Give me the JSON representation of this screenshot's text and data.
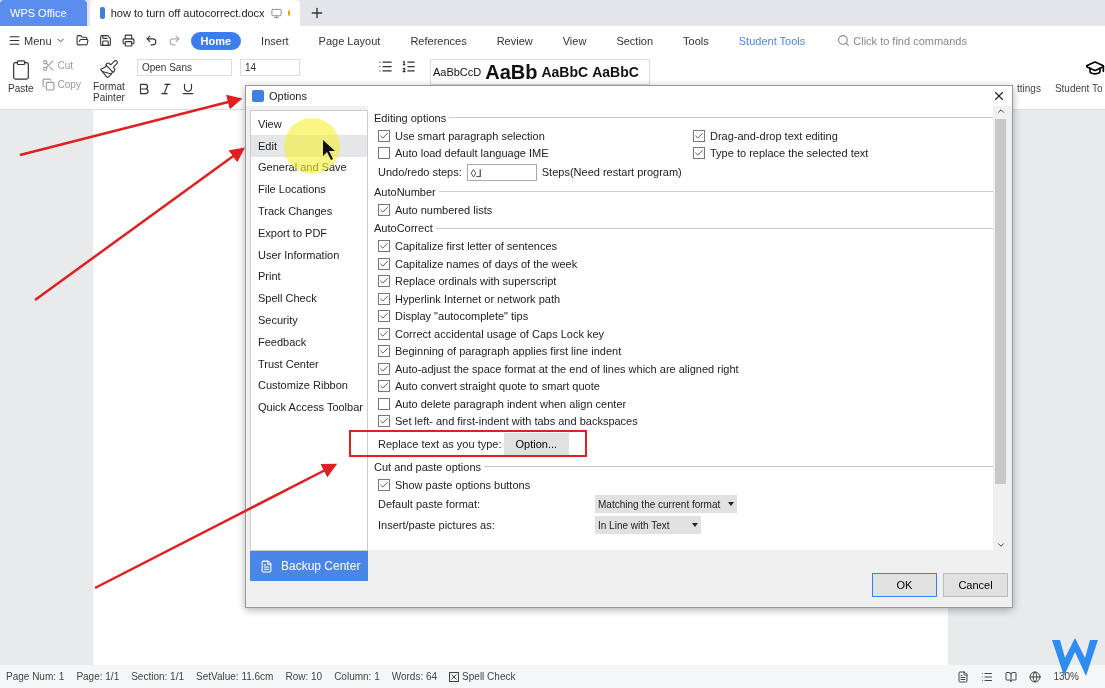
{
  "app_tabs": [
    {
      "label": "WPS Office",
      "selected": false
    },
    {
      "label": "how to turn off autocorrect.docx",
      "selected": true
    }
  ],
  "menu": {
    "label": "Menu"
  },
  "ribbon_tabs": [
    {
      "label": "Home",
      "selected": true
    },
    {
      "label": "Insert",
      "selected": false
    },
    {
      "label": "Page Layout",
      "selected": false
    },
    {
      "label": "References",
      "selected": false
    },
    {
      "label": "Review",
      "selected": false
    },
    {
      "label": "View",
      "selected": false
    },
    {
      "label": "Section",
      "selected": false
    },
    {
      "label": "Tools",
      "selected": false
    },
    {
      "label": "Student Tools",
      "selected": false
    }
  ],
  "search": {
    "placeholder": "Click to find commands"
  },
  "ribbon": {
    "paste": "Paste",
    "cut": "Cut",
    "copy": "Copy",
    "format_painter": "Format Painter",
    "font": "Open Sans",
    "size": "14",
    "styles": [
      "AaBbCcD",
      "AaBb",
      "AaBbC",
      "AaBbC"
    ],
    "settings": "ttings",
    "student": "Student To"
  },
  "dialog": {
    "title": "Options",
    "nav": [
      {
        "label": "View",
        "selected": false
      },
      {
        "label": "Edit",
        "selected": true
      },
      {
        "label": "General and Save",
        "selected": false
      },
      {
        "label": "File Locations",
        "selected": false
      },
      {
        "label": "Track Changes",
        "selected": false
      },
      {
        "label": "Export to PDF",
        "selected": false
      },
      {
        "label": "User Information",
        "selected": false
      },
      {
        "label": "Print",
        "selected": false
      },
      {
        "label": "Spell Check",
        "selected": false
      },
      {
        "label": "Security",
        "selected": false
      },
      {
        "label": "Feedback",
        "selected": false
      },
      {
        "label": "Trust Center",
        "selected": false
      },
      {
        "label": "Customize Ribbon",
        "selected": false
      },
      {
        "label": "Quick Access Toolbar",
        "selected": false
      }
    ],
    "backup": "Backup Center",
    "sections": [
      {
        "title": "Editing options",
        "rows": [
          {
            "kind": "check",
            "label": "Use smart paragraph selection",
            "checked": true
          },
          {
            "kind": "check",
            "label": "Auto load default language IME",
            "checked": false
          },
          {
            "kind": "spin",
            "label": "Undo/redo steps:",
            "value": "◊⅃",
            "suffix": "Steps(Need restart program)"
          }
        ],
        "side_rows": [
          {
            "kind": "check",
            "label": "Drag-and-drop text editing",
            "checked": true
          },
          {
            "kind": "check",
            "label": "Type to replace the selected text",
            "checked": true
          }
        ]
      },
      {
        "title": "AutoNumber",
        "rows": [
          {
            "kind": "check",
            "label": "Auto numbered lists",
            "checked": true
          }
        ]
      },
      {
        "title": "AutoCorrect",
        "rows": [
          {
            "kind": "check",
            "label": "Capitalize first letter of sentences",
            "checked": true
          },
          {
            "kind": "check",
            "label": "Capitalize names of days of the week",
            "checked": true
          },
          {
            "kind": "check",
            "label": "Replace ordinals with superscript",
            "checked": true
          },
          {
            "kind": "check",
            "label": "Hyperlink Internet or network path",
            "checked": true
          },
          {
            "kind": "check",
            "label": "Display \"autocomplete\" tips",
            "checked": true
          },
          {
            "kind": "check",
            "label": "Correct accidental usage of Caps Lock key",
            "checked": true
          },
          {
            "kind": "check",
            "label": "Beginning of paragraph applies first line indent",
            "checked": true
          },
          {
            "kind": "check",
            "label": "Auto-adjust the space format at the end of lines which are aligned right",
            "checked": true
          },
          {
            "kind": "check",
            "label": "Auto convert straight quote to smart quote",
            "checked": true
          },
          {
            "kind": "check",
            "label": "Auto delete paragraph indent when align center",
            "checked": false
          },
          {
            "kind": "check",
            "label": "Set left- and first-indent with tabs and backspaces",
            "checked": true
          },
          {
            "kind": "button",
            "label": "Replace text as you type:",
            "button": "Option...",
            "highlighted": true
          }
        ]
      },
      {
        "title": "Cut and paste options",
        "rows": [
          {
            "kind": "check",
            "label": "Show paste options buttons",
            "checked": true
          },
          {
            "kind": "select",
            "label": "Default paste format:",
            "value": "Matching the current format"
          },
          {
            "kind": "select",
            "label": "Insert/paste pictures as:",
            "value": "In Line with Text"
          }
        ]
      }
    ],
    "buttons": [
      {
        "label": "OK",
        "primary": true
      },
      {
        "label": "Cancel",
        "primary": false
      }
    ]
  },
  "status_bar": {
    "items": [
      "Page Num: 1",
      "Page: 1/1",
      "Section: 1/1",
      "SetValue: 11.6cm",
      "Row: 10",
      "Column: 1",
      "Words: 64"
    ],
    "spell": "Spell Check",
    "zoom": "130%"
  }
}
